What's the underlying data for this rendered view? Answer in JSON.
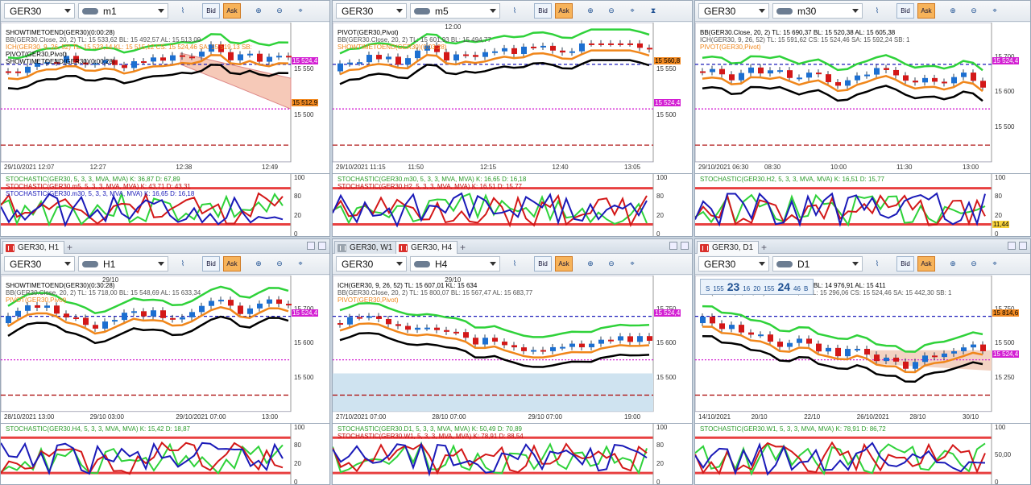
{
  "panels": [
    {
      "symbol": "GER30",
      "timeframe": "m1",
      "legend": [
        "SHOWTIMETOEND(GER30)(0:00:28)",
        "BB(GER30.Close, 20, 2)  TL: 15 533,62  BL: 15 492,57  AL: 15 513,09",
        "ICH(GER30, 9, 26, 52)  TL: 15 523,14  KL: 15 515,12  CS: 15 524,46  SA: 15 519,13  SB:",
        "PIVOT(GER30,Pivot)",
        "SHOWTIMETOEND(GER30)(0:00:28)"
      ],
      "yticks": [
        "15 550",
        "15 500"
      ],
      "tags": [
        {
          "v": "15 524,4",
          "c": "#d31fd3"
        },
        {
          "v": "15 512,9",
          "c": "#f28a22"
        }
      ],
      "xticks": [
        "29/10/2021 12:07",
        "12:27",
        "12:38",
        "12:49"
      ],
      "osc": [
        "STOCHASTIC(GER30, 5, 3, 3, MVA, MVA)  K: 36,87  D: 67,89",
        "STOCHASTIC(GER30.m5, 5, 3, 3, MVA, MVA)  K: 43,71  D: 43,31",
        "STOCHASTIC(GER30.m30, 5, 3, 3, MVA, MVA)  K: 16,65  D: 16,18"
      ],
      "oscticks": [
        "100",
        "80",
        "20",
        "0"
      ]
    },
    {
      "symbol": "GER30",
      "timeframe": "m5",
      "legend": [
        "PIVOT(GER30,Pivot)",
        "BB(GER30.Close, 20, 2)  TL: 15 601,93  BL: 15 494,77",
        "SHOWTIMETOEND(GER30)(0:03:28)"
      ],
      "top": "12:00",
      "yticks": [
        "15 550",
        "15 500"
      ],
      "tags": [
        {
          "v": "15 560,8",
          "c": "#f28a22"
        },
        {
          "v": "15 524,4",
          "c": "#d31fd3"
        }
      ],
      "xticks": [
        "29/10/2021 11:15",
        "11:50",
        "12:15",
        "12:40",
        "13:05"
      ],
      "osc": [
        "STOCHASTIC(GER30.m30, 5, 3, 3, MVA, MVA)  K: 16,65  D: 16,18",
        "STOCHASTIC(GER30.H2, 5, 3, 3, MVA, MVA)  K: 16,51  D: 15,77"
      ],
      "oscticks": [
        "100",
        "80",
        "20",
        "0"
      ]
    },
    {
      "symbol": "GER30",
      "timeframe": "m30",
      "legend": [
        "BB(GER30.Close, 20, 2)  TL: 15 690,37  BL: 15 520,38  AL: 15 605,38",
        "ICH(GER30, 9, 26, 52)  TL: 15 591,62  CS: 15 524,46  SA: 15 592,24  SB: 1",
        "PIVOT(GER30,Pivot)"
      ],
      "yticks": [
        "15 700",
        "15 600",
        "15 500"
      ],
      "tags": [
        {
          "v": "15 524,4",
          "c": "#d31fd3"
        }
      ],
      "xticks": [
        "29/10/2021 06:30",
        "08:30",
        "10:00",
        "11:30",
        "13:00"
      ],
      "osc": [
        "STOCHASTIC(GER30.H2, 5, 3, 3, MVA, MVA)  K: 16,51  D: 15,77"
      ],
      "oscticks": [
        "100",
        "80",
        "20",
        "0"
      ],
      "oscTag": "11,44"
    },
    {
      "symbol": "GER30",
      "timeframe": "H1",
      "tabs": [
        "GER30, H1"
      ],
      "top": "29/10",
      "legend": [
        "SHOWTIMETOEND(GER30)(0:30:28)",
        "BB(GER30.Close, 20, 2)  TL: 15 718,00  BL: 15 548,69  AL: 15 633,34",
        "PIVOT(GER30,Pivot)"
      ],
      "yticks": [
        "15 700",
        "15 600",
        "15 500"
      ],
      "tags": [
        {
          "v": "15 524,4",
          "c": "#d31fd3"
        }
      ],
      "xticks": [
        "28/10/2021 13:00",
        "29/10 03:00",
        "29/10/2021 07:00",
        "13:00"
      ],
      "osc": [
        "STOCHASTIC(GER30.H4, 5, 3, 3, MVA, MVA)  K: 15,42  D: 18,87"
      ],
      "oscticks": [
        "100",
        "80",
        "20",
        "0"
      ]
    },
    {
      "symbol": "GER30",
      "timeframe": "H4",
      "tabs": [
        "GER30, W1",
        "GER30, H4"
      ],
      "top": "29/10",
      "legend": [
        "ICH(GER30, 9, 26, 52)  TL: 15 607,01  KL: 15 634",
        "BB(GER30.Close, 20, 2)  TL: 15 800,07  BL: 15 567,47  AL: 15 683,77",
        "PIVOT(GER30,Pivot)"
      ],
      "yticks": [
        "15 750",
        "15 600",
        "15 500"
      ],
      "tags": [
        {
          "v": "15 524,4",
          "c": "#d31fd3"
        }
      ],
      "xticks": [
        "27/10/2021 07:00",
        "28/10 07:00",
        "29/10 07:00",
        "19:00"
      ],
      "osc": [
        "STOCHASTIC(GER30.D1, 5, 3, 3, MVA, MVA)  K: 50,49  D: 70,89",
        "STOCHASTIC(GER30.W1, 5, 3, 3, MVA, MVA)  K: 78,91  D: 88,54"
      ],
      "oscticks": [
        "100",
        "80",
        "20",
        "0"
      ]
    },
    {
      "symbol": "GER30",
      "timeframe": "D1",
      "tabs": [
        "GER30, D1"
      ],
      "legend": [
        "BB(GER30.Close, 20, 2)  TL: 15 849,99  BL: 14 976,91  AL: 15 411",
        "ICH(GER30, 9, 26, 52)  TL: 15 588,00  KL: 15 296,06  CS: 15 524,46  SA: 15 442,30  SB: 1"
      ],
      "quote": {
        "s": "S",
        "bid": "23",
        "bidsup": "16",
        "sp": "20",
        "ask": "24",
        "asksup": "46",
        "b": "B",
        "lot": "155"
      },
      "yticks": [
        "15 750",
        "15 500",
        "15 250"
      ],
      "tags": [
        {
          "v": "15 814,6",
          "c": "#f28a22"
        },
        {
          "v": "15 524,4",
          "c": "#d31fd3"
        }
      ],
      "xticks": [
        "14/10/2021",
        "20/10",
        "22/10",
        "26/10/2021",
        "28/10",
        "30/10"
      ],
      "osc": [
        "STOCHASTIC(GER30.W1, 5, 3, 3, MVA, MVA)  K: 78,91  D: 86,72"
      ],
      "oscticks": [
        "100",
        "50,00",
        "0"
      ]
    }
  ],
  "toolbar": {
    "bid": "Bid",
    "ask": "Ask"
  }
}
